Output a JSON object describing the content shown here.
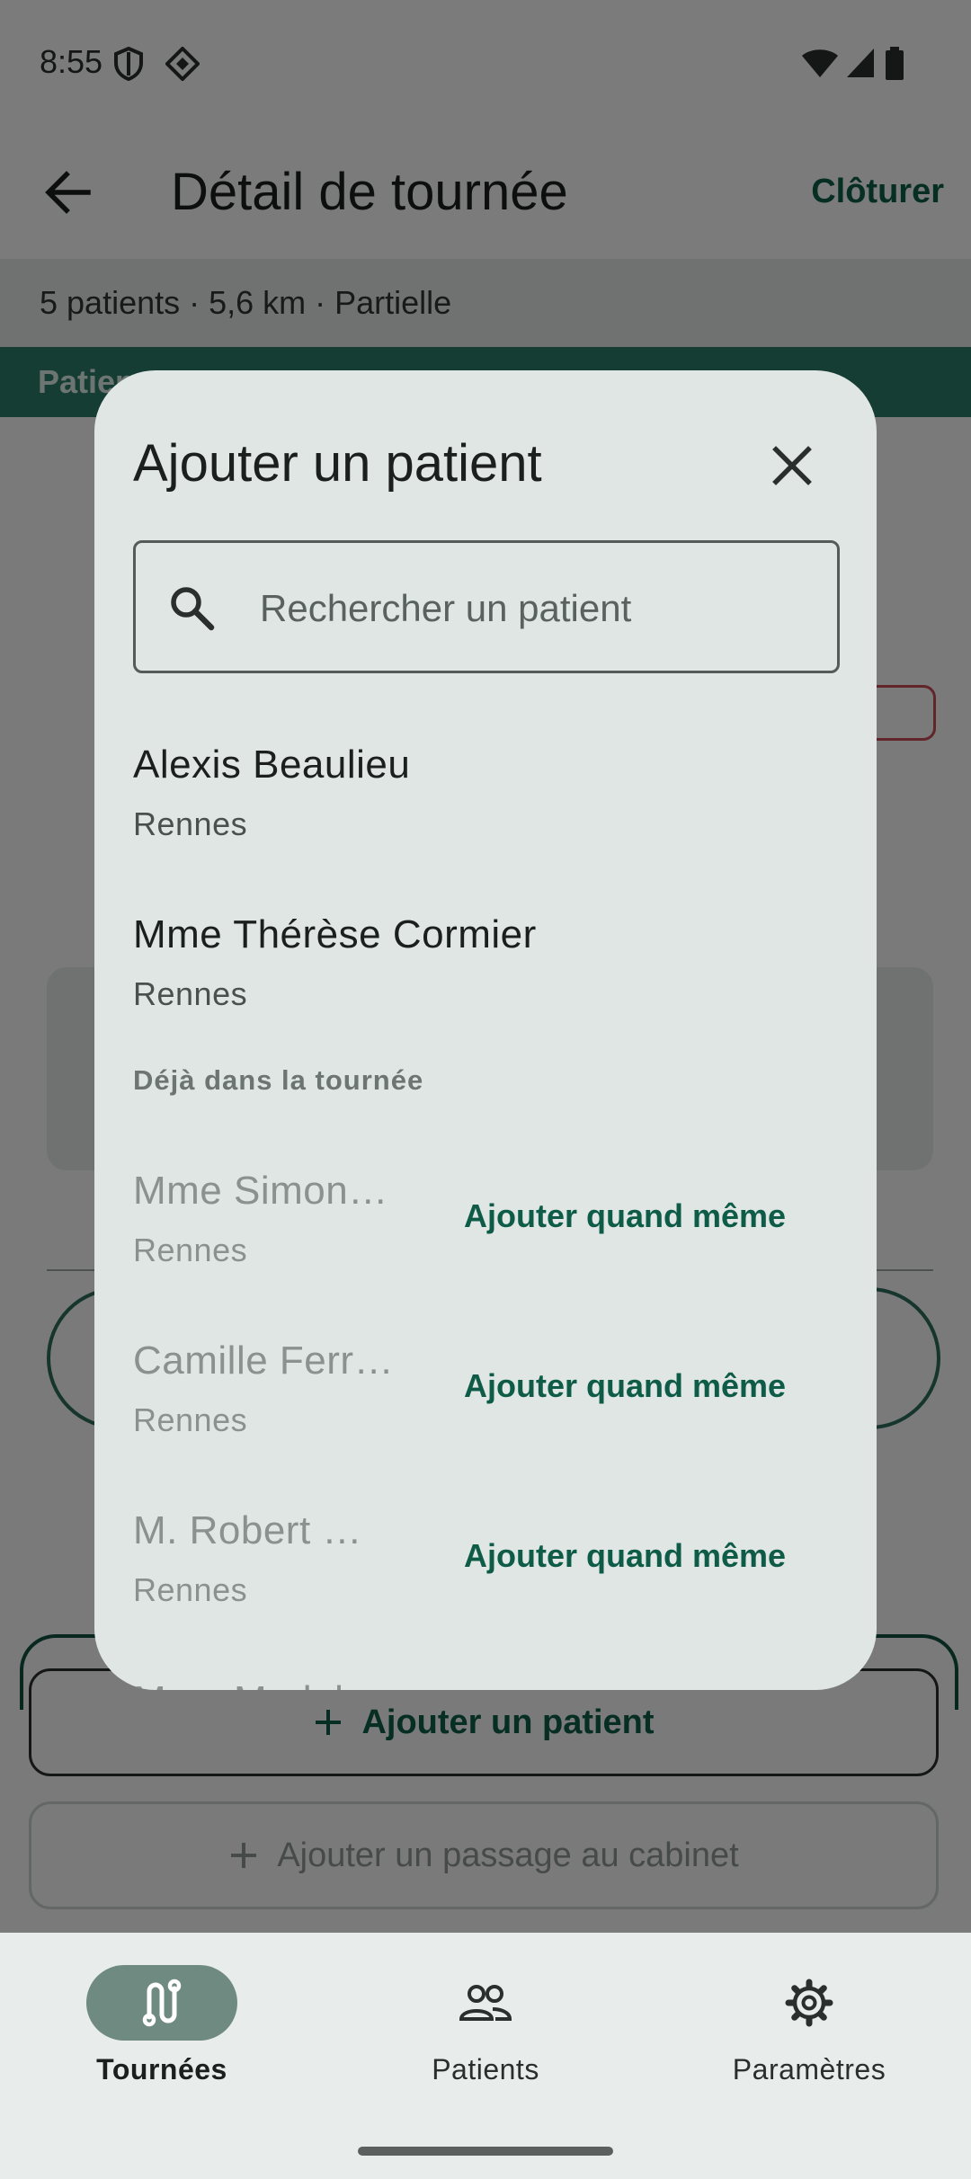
{
  "status_bar": {
    "time": "8:55"
  },
  "app_bar": {
    "title": "Détail de tournée",
    "action": "Clôturer"
  },
  "summary": "5 patients · 5,6 km · Partielle",
  "tab_band": {
    "label": "Patien"
  },
  "background_actions": {
    "add_patient": "Ajouter un patient",
    "add_cabinet_visit": "Ajouter un passage au cabinet"
  },
  "dialog": {
    "title": "Ajouter un patient",
    "search_placeholder": "Rechercher un patient",
    "results": [
      {
        "name": "Alexis Beaulieu",
        "city": "Rennes"
      },
      {
        "name": "Mme Thérèse Cormier",
        "city": "Rennes"
      }
    ],
    "already_section": "Déjà dans la tournée",
    "already": [
      {
        "name": "Mme Simon…",
        "city": "Rennes",
        "action": "Ajouter quand même"
      },
      {
        "name": "Camille Ferr…",
        "city": "Rennes",
        "action": "Ajouter quand même"
      },
      {
        "name": "M. Robert M…",
        "city": "Rennes",
        "action": "Ajouter quand même"
      },
      {
        "name": "Mme Madel…",
        "city": "",
        "action": ""
      }
    ]
  },
  "bottom_nav": {
    "items": [
      {
        "label": "Tournées",
        "icon": "route-icon",
        "active": true
      },
      {
        "label": "Patients",
        "icon": "people-icon",
        "active": false
      },
      {
        "label": "Paramètres",
        "icon": "gear-icon",
        "active": false
      }
    ]
  },
  "colors": {
    "accent": "#0e5c47",
    "dialog_bg": "#e0e6e4",
    "nav_active_pill": "#6f8b81",
    "warning": "#c24a55"
  }
}
